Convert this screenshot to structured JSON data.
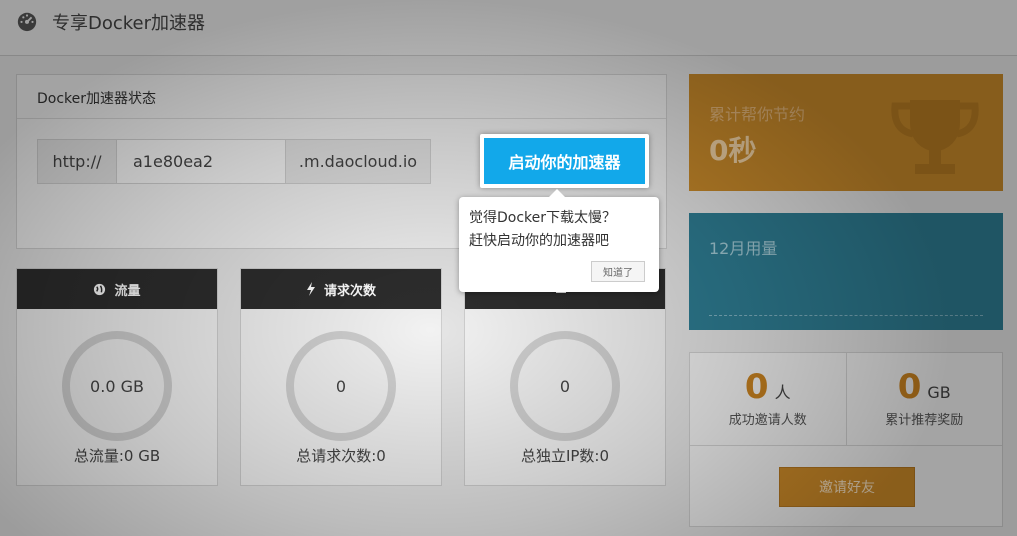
{
  "header": {
    "title": "专享Docker加速器",
    "icon": "gauge-icon"
  },
  "status_panel": {
    "title": "Docker加速器状态",
    "url_prefix": "http://",
    "url_id": "a1e80ea2",
    "url_suffix": ".m.daocloud.io",
    "start_button": "启动你的加速器"
  },
  "tooltip": {
    "line1": "觉得Docker下载太慢？",
    "line2": "赶快启动你的加速器吧",
    "ok_button": "知道了"
  },
  "stats": [
    {
      "icon": "globe-icon",
      "title": "流量",
      "value": "0.0 GB",
      "total": "总流量:0 GB"
    },
    {
      "icon": "lightning-icon",
      "title": "请求次数",
      "value": "0",
      "total": "总请求次数:0"
    },
    {
      "icon": "ip-icon",
      "title": "",
      "value": "0",
      "total": "总独立IP数:0"
    }
  ],
  "saved": {
    "label": "累计帮你节约",
    "value": "0秒",
    "icon": "trophy-icon"
  },
  "usage": {
    "label": "12月用量"
  },
  "invite": {
    "count": "0",
    "count_unit": "人",
    "count_caption": "成功邀请人数",
    "reward": "0",
    "reward_unit": "GB",
    "reward_caption": "累计推荐奖励",
    "button": "邀请好友"
  },
  "colors": {
    "accent_blue": "#12a8ea",
    "gold": "#c7892a",
    "teal": "#2e7d93",
    "dark_header": "#2d2d2d"
  }
}
